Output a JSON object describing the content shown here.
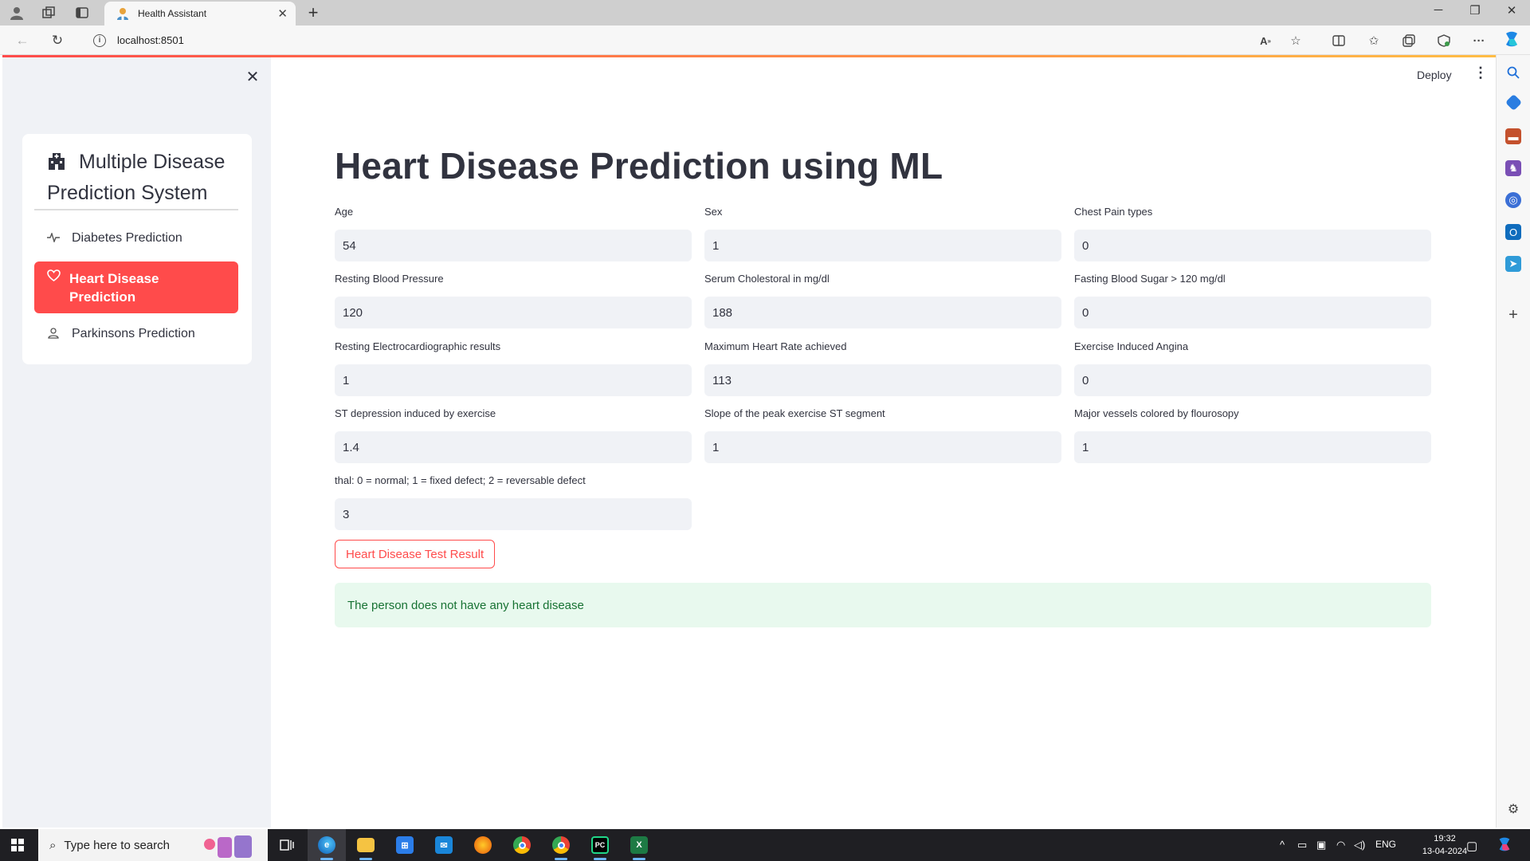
{
  "browser": {
    "tab_title": "Health Assistant",
    "url": "localhost:8501"
  },
  "app": {
    "deploy_label": "Deploy"
  },
  "sidebar": {
    "menu_title": "Multiple Disease Prediction System",
    "items": [
      {
        "label": "Diabetes Prediction",
        "icon": "activity-icon",
        "active": false
      },
      {
        "label": "Heart Disease Prediction",
        "icon": "heart-icon",
        "active": true
      },
      {
        "label": "Parkinsons Prediction",
        "icon": "person-icon",
        "active": false
      }
    ]
  },
  "main": {
    "title": "Heart Disease Prediction using ML",
    "fields": [
      {
        "label": "Age",
        "value": "54"
      },
      {
        "label": "Sex",
        "value": "1"
      },
      {
        "label": "Chest Pain types",
        "value": "0"
      },
      {
        "label": "Resting Blood Pressure",
        "value": "120"
      },
      {
        "label": "Serum Cholestoral in mg/dl",
        "value": "188"
      },
      {
        "label": "Fasting Blood Sugar > 120 mg/dl",
        "value": "0"
      },
      {
        "label": "Resting Electrocardiographic results",
        "value": "1"
      },
      {
        "label": "Maximum Heart Rate achieved",
        "value": "113"
      },
      {
        "label": "Exercise Induced Angina",
        "value": "0"
      },
      {
        "label": "ST depression induced by exercise",
        "value": "1.4"
      },
      {
        "label": "Slope of the peak exercise ST segment",
        "value": "1"
      },
      {
        "label": "Major vessels colored by flourosopy",
        "value": "1"
      },
      {
        "label": "thal: 0 = normal; 1 = fixed defect; 2 = reversable defect",
        "value": "3"
      }
    ],
    "button_label": "Heart Disease Test Result",
    "result_text": "The person does not have any heart disease"
  },
  "taskbar": {
    "search_placeholder": "Type here to search",
    "language": "ENG",
    "time": "19:32",
    "date": "13-04-2024"
  },
  "colors": {
    "accent": "#ff4b4b",
    "success_bg": "#e8f9ee",
    "success_text": "#177233",
    "sidebar_bg": "#f0f2f6"
  }
}
